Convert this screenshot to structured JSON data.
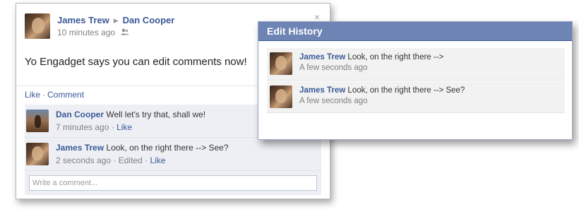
{
  "post": {
    "author": "James Trew",
    "arrow": "▶",
    "recipient": "Dan Cooper",
    "time": "10 minutes ago",
    "audience_icon": "friends-icon",
    "close_glyph": "×",
    "message": "Yo Engadget says you can edit comments now!",
    "actions": {
      "like": "Like",
      "separator": "·",
      "comment": "Comment"
    }
  },
  "comments": [
    {
      "author": "Dan Cooper",
      "text": "Well let's try that, shall we!",
      "time": "7 minutes ago",
      "separator": "·",
      "like": "Like"
    },
    {
      "author": "James Trew",
      "text": "Look, on the right there --> See?",
      "time": "2 seconds ago",
      "separator": "·",
      "edited": "Edited",
      "like": "Like"
    }
  ],
  "write_comment": {
    "placeholder": "Write a comment..."
  },
  "edit_history": {
    "title": "Edit History",
    "items": [
      {
        "author": "James Trew",
        "text": "Look, on the right there -->",
        "time": "A few seconds ago"
      },
      {
        "author": "James Trew",
        "text": "Look, on the right there --> See?",
        "time": "A few seconds ago"
      }
    ]
  },
  "colors": {
    "link": "#3b5998",
    "title_bar": "#6d84b4",
    "comment_bg": "#edeff4"
  }
}
